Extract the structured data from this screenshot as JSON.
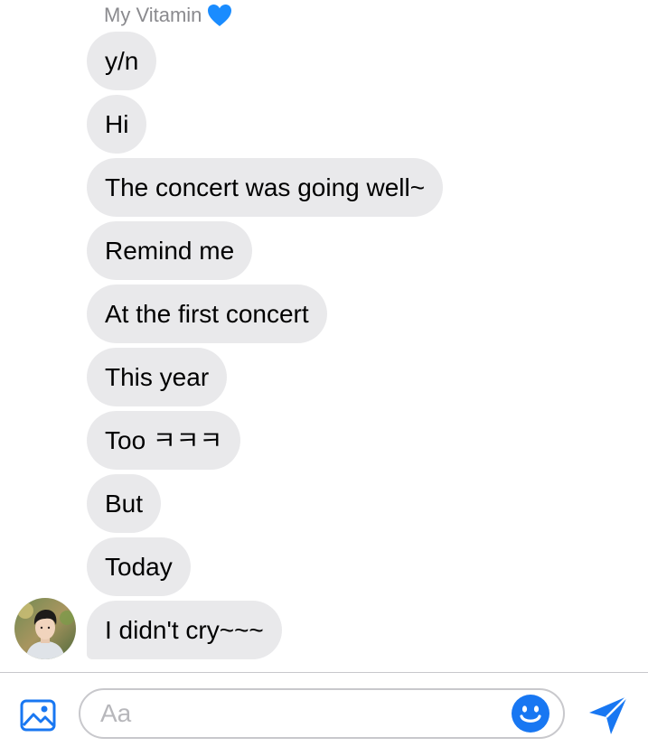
{
  "conversation": {
    "sender_name": "My Vitamin",
    "sender_heart_icon": "blue-heart-icon",
    "messages": [
      "y/n",
      "Hi",
      "The concert was going well~",
      "Remind me",
      "At the first concert",
      "This year",
      "Too ㅋㅋㅋ",
      "But",
      "Today",
      "I didn't cry~~~"
    ]
  },
  "composer": {
    "placeholder": "Aa",
    "photo_icon": "image-icon",
    "emoji_icon": "smiley-icon",
    "send_icon": "send-icon"
  },
  "colors": {
    "accent": "#1877f2",
    "bubble_background": "#e9e9eb",
    "sender_name": "#8a8a8e",
    "heart": "#1a8cff"
  }
}
